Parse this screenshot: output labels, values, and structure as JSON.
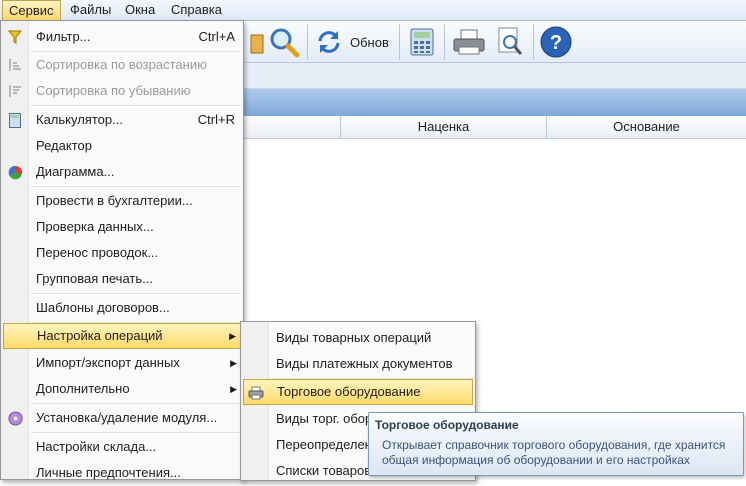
{
  "menubar": {
    "items": [
      {
        "label": "Сервис"
      },
      {
        "label": "Файлы"
      },
      {
        "label": "Окна"
      },
      {
        "label": "Справка"
      }
    ]
  },
  "toolbar": {
    "refresh_label": "Обнов"
  },
  "table": {
    "columns": [
      {
        "label": "Наценка"
      },
      {
        "label": "Основание"
      }
    ]
  },
  "service_menu": {
    "items": [
      {
        "label": "Фильтр...",
        "shortcut": "Ctrl+A",
        "icon": "filter-icon"
      },
      {
        "label": "Сортировка по возрастанию",
        "icon": "sort-ascending-icon",
        "disabled": true
      },
      {
        "label": "Сортировка по убыванию",
        "icon": "sort-descending-icon",
        "disabled": true
      },
      {
        "label": "Калькулятор...",
        "shortcut": "Ctrl+R",
        "icon": "calculator-icon"
      },
      {
        "label": "Редактор"
      },
      {
        "label": "Диаграмма...",
        "icon": "pie-chart-icon"
      },
      {
        "label": "Провести в бухгалтерии..."
      },
      {
        "label": "Проверка данных..."
      },
      {
        "label": "Перенос проводок..."
      },
      {
        "label": "Групповая печать..."
      },
      {
        "label": "Шаблоны договоров..."
      },
      {
        "label": "Настройка операций",
        "highlighted": true
      },
      {
        "label": "Импорт/экспорт данных"
      },
      {
        "label": "Дополнительно"
      },
      {
        "label": "Установка/удаление модуля...",
        "icon": "disc-icon"
      },
      {
        "label": "Настройки склада..."
      },
      {
        "label": "Личные предпочтения..."
      }
    ]
  },
  "submenu": {
    "items": [
      {
        "label": "Виды товарных операций"
      },
      {
        "label": "Виды платежных документов"
      },
      {
        "label": "Торговое оборудование",
        "highlighted": true,
        "icon": "printer-icon"
      },
      {
        "label": "Виды торг. обор"
      },
      {
        "label": "Переопределен"
      },
      {
        "label": "Списки товаров"
      }
    ]
  },
  "tooltip": {
    "title": "Торговое оборудование",
    "description": "Открывает справочник торгового оборудования, где хранится общая информация об оборудовании и его настройках"
  }
}
